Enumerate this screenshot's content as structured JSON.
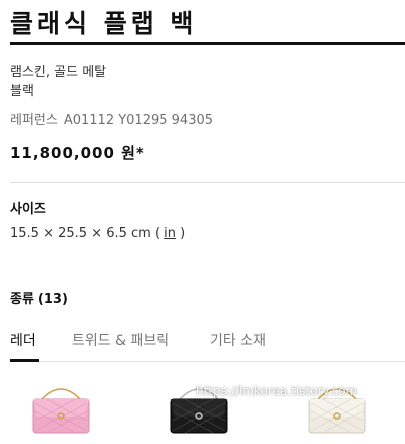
{
  "product": {
    "title": "클래식 플랩 백",
    "material": "램스킨, 골드 메탈",
    "color": "블랙",
    "reference_label": "레퍼런스",
    "reference_code": "A01112 Y01295 94305",
    "price": "11,800,000 원*"
  },
  "size": {
    "heading": "사이즈",
    "dimensions_prefix": "15.5 × 25.5 × 6.5 cm ( ",
    "unit_link": "in",
    "dimensions_suffix": " )"
  },
  "variants": {
    "heading": "종류",
    "count": "(13)",
    "tabs": [
      {
        "label": "레더",
        "active": true
      },
      {
        "label": "트위드 & 패브릭",
        "active": false
      },
      {
        "label": "기타 소재",
        "active": false
      }
    ],
    "thumbnails": [
      {
        "name": "pink-bag",
        "color": "#f0a9c8"
      },
      {
        "name": "black-patent-bag",
        "color": "#1a1a1a"
      },
      {
        "name": "white-bag",
        "color": "#efebe2"
      }
    ]
  },
  "watermark": "https://lmkorea.tistory.com",
  "colors": {
    "text_primary": "#111111",
    "text_secondary": "#6f6f6f",
    "divider": "#dcdcdc",
    "accent": "#111111"
  }
}
